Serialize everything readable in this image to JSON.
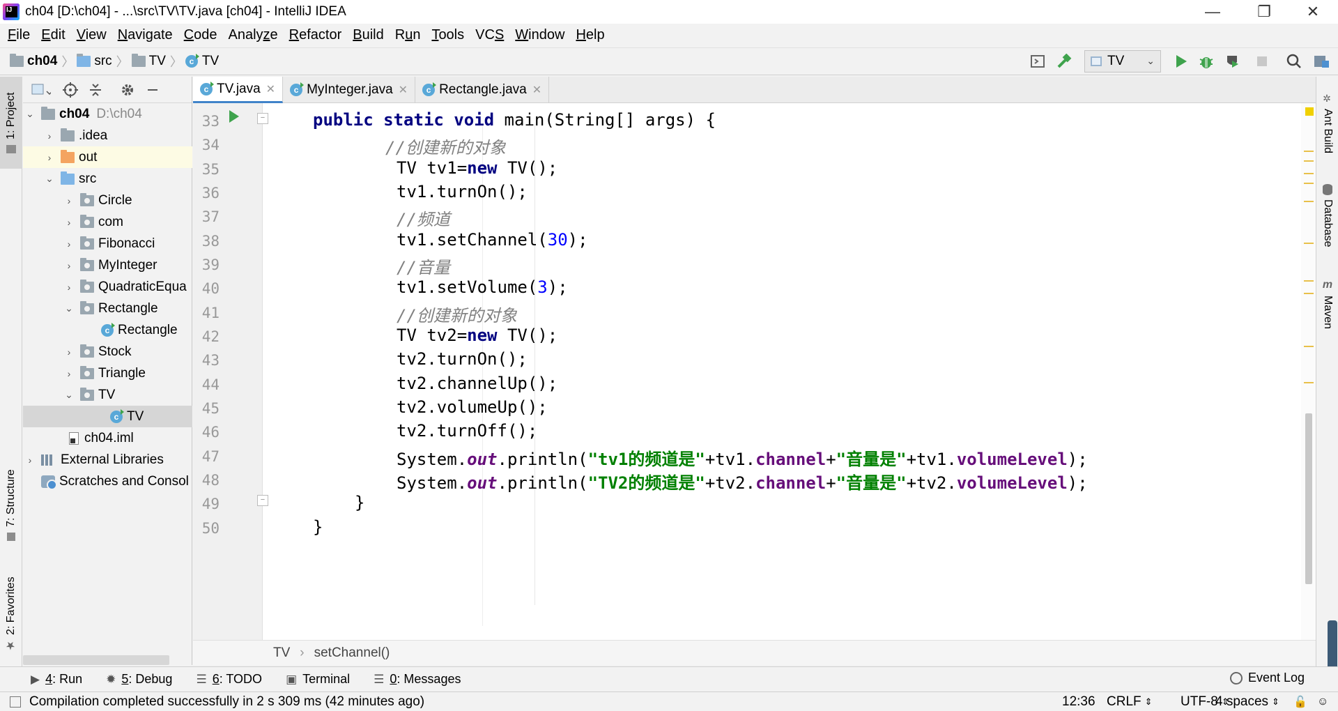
{
  "window": {
    "title": "ch04 [D:\\ch04] - ...\\src\\TV\\TV.java [ch04] - IntelliJ IDEA",
    "minimize": "—",
    "restore": "❐",
    "close": "✕"
  },
  "menu": [
    {
      "ul": "F",
      "rest": "ile"
    },
    {
      "ul": "E",
      "rest": "dit"
    },
    {
      "ul": "V",
      "rest": "iew"
    },
    {
      "ul": "N",
      "rest": "avigate"
    },
    {
      "ul": "C",
      "rest": "ode"
    },
    {
      "pre": "Analy",
      "ul": "z",
      "rest": "e"
    },
    {
      "ul": "R",
      "rest": "efactor"
    },
    {
      "ul": "B",
      "rest": "uild"
    },
    {
      "pre": "R",
      "ul": "u",
      "rest": "n"
    },
    {
      "ul": "T",
      "rest": "ools"
    },
    {
      "pre": "VC",
      "ul": "S",
      "rest": ""
    },
    {
      "ul": "W",
      "rest": "indow"
    },
    {
      "ul": "H",
      "rest": "elp"
    }
  ],
  "navbar": {
    "crumbs": [
      "ch04",
      "src",
      "TV",
      "TV"
    ],
    "run_config": "TV"
  },
  "left_stripe": {
    "project": "1: Project",
    "structure": "7: Structure",
    "favorites": "2: Favorites"
  },
  "right_stripe": {
    "ant": "Ant Build",
    "database": "Database",
    "maven": "Maven",
    "maven_glyph": "m"
  },
  "project_tree": {
    "root_name": "ch04",
    "root_path": "D:\\ch04",
    "items": [
      "ch04",
      ".idea",
      "out",
      "src",
      "Circle",
      "com",
      "Fibonacci",
      "MyInteger",
      "QuadraticEqua",
      "Rectangle",
      "Rectangle",
      "Stock",
      "Triangle",
      "TV",
      "TV",
      "ch04.iml",
      "External Libraries",
      "Scratches and Consol"
    ]
  },
  "tabs": [
    "TV.java",
    "MyInteger.java",
    "Rectangle.java"
  ],
  "editor": {
    "line_numbers": [
      "33",
      "34",
      "35",
      "36",
      "37",
      "38",
      "39",
      "40",
      "41",
      "42",
      "43",
      "44",
      "45",
      "46",
      "47",
      "48",
      "49",
      "50"
    ],
    "code": {
      "l33": {
        "kw1": "public static void",
        "rest": " main(String[] args) {"
      },
      "l34": "//创建新的对象",
      "l35": {
        "a": "TV tv1=",
        "kw": "new",
        "b": " TV();"
      },
      "l36": "tv1.turnOn();",
      "l37": "//频道",
      "l38": {
        "a": "tv1.setChannel(",
        "num": "30",
        "b": ");"
      },
      "l39": "//音量",
      "l40": {
        "a": "tv1.setVolume(",
        "num": "3",
        "b": ");"
      },
      "l41": "//创建新的对象",
      "l42": {
        "a": "TV tv2=",
        "kw": "new",
        "b": " TV();"
      },
      "l43": "tv2.turnOn();",
      "l44": "tv2.channelUp();",
      "l45": "tv2.volumeUp();",
      "l46": "tv2.turnOff();",
      "l47": {
        "a": "System.",
        "out": "out",
        "b": ".println(",
        "s1": "\"tv1的频道是\"",
        "c": "+tv1.",
        "f1": "channel",
        "d": "+",
        "s2": "\"音量是\"",
        "e": "+tv1.",
        "f2": "volumeLevel",
        "g": ");"
      },
      "l48": {
        "a": "System.",
        "out": "out",
        "b": ".println(",
        "s1": "\"TV2的频道是\"",
        "c": "+tv2.",
        "f1": "channel",
        "d": "+",
        "s2": "\"音量是\"",
        "e": "+tv2.",
        "f2": "volumeLevel",
        "g": ");"
      },
      "l49": "}",
      "l50": "}"
    }
  },
  "editor_breadcrumb": [
    "TV",
    "setChannel()"
  ],
  "tool_tabs": [
    {
      "n": "4",
      "label": ": Run"
    },
    {
      "n": "5",
      "label": ": Debug"
    },
    {
      "n": "6",
      "label": ": TODO"
    },
    {
      "n": "",
      "label": "Terminal"
    },
    {
      "n": "0",
      "label": ": Messages"
    }
  ],
  "event_log": "Event Log",
  "status": {
    "message": "Compilation completed successfully in 2 s 309 ms (42 minutes ago)",
    "position": "12:36",
    "line_sep": "CRLF",
    "encoding": "UTF-8",
    "indent": "4 spaces"
  },
  "colors": {
    "keyword": "#000080",
    "comment": "#808080",
    "number": "#0000ff",
    "string": "#008000",
    "field": "#660e7a",
    "run_green": "#3fa34d",
    "tab_accent": "#4083c9"
  }
}
